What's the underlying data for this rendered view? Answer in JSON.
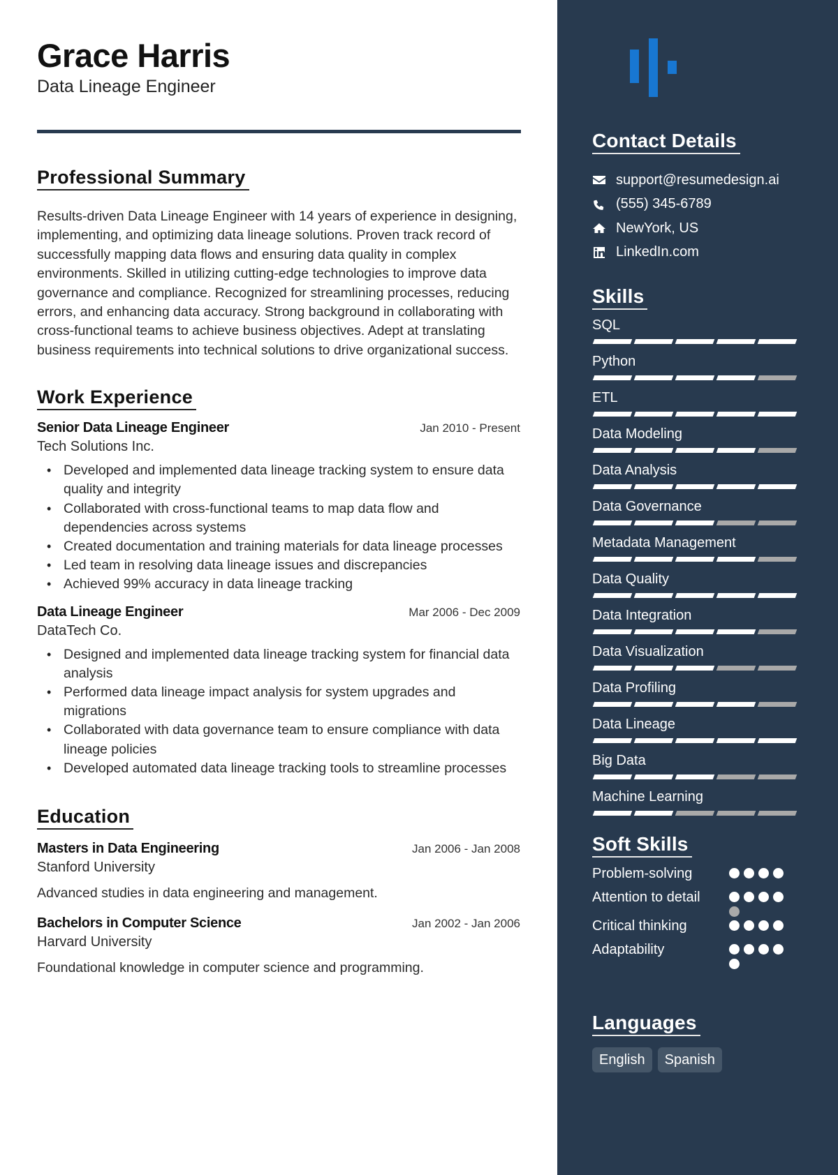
{
  "header": {
    "name": "Grace Harris",
    "title": "Data Lineage Engineer"
  },
  "summary": {
    "heading": "Professional Summary",
    "text": "Results-driven Data Lineage Engineer with 14 years of experience in designing, implementing, and optimizing data lineage solutions. Proven track record of successfully mapping data flows and ensuring data quality in complex environments. Skilled in utilizing cutting-edge technologies to improve data governance and compliance. Recognized for streamlining processes, reducing errors, and enhancing data accuracy. Strong background in collaborating with cross-functional teams to achieve business objectives. Adept at translating business requirements into technical solutions to drive organizational success."
  },
  "work": {
    "heading": "Work Experience",
    "entries": [
      {
        "role": "Senior Data Lineage Engineer",
        "dates": "Jan 2010 - Present",
        "company": "Tech Solutions Inc.",
        "bullets": [
          "Developed and implemented data lineage tracking system to ensure data quality and integrity",
          "Collaborated with cross-functional teams to map data flow and dependencies across systems",
          "Created documentation and training materials for data lineage processes",
          "Led team in resolving data lineage issues and discrepancies",
          "Achieved 99% accuracy in data lineage tracking"
        ]
      },
      {
        "role": "Data Lineage Engineer",
        "dates": "Mar 2006 - Dec 2009",
        "company": "DataTech Co.",
        "bullets": [
          "Designed and implemented data lineage tracking system for financial data analysis",
          "Performed data lineage impact analysis for system upgrades and migrations",
          "Collaborated with data governance team to ensure compliance with data lineage policies",
          "Developed automated data lineage tracking tools to streamline processes"
        ]
      }
    ]
  },
  "education": {
    "heading": "Education",
    "entries": [
      {
        "degree": "Masters in Data Engineering",
        "dates": "Jan 2006 - Jan 2008",
        "school": "Stanford University",
        "description": "Advanced studies in data engineering and management."
      },
      {
        "degree": "Bachelors in Computer Science",
        "dates": "Jan 2002 - Jan 2006",
        "school": "Harvard University",
        "description": "Foundational knowledge in computer science and programming."
      }
    ]
  },
  "sidebar": {
    "logo_icon": "bar-signal-logo",
    "contact": {
      "heading": "Contact Details",
      "items": [
        {
          "icon": "envelope-icon",
          "text": "support@resumedesign.ai"
        },
        {
          "icon": "phone-icon",
          "text": "(555) 345-6789"
        },
        {
          "icon": "home-icon",
          "text": "NewYork, US"
        },
        {
          "icon": "linkedin-icon",
          "text": "LinkedIn.com"
        }
      ]
    },
    "skills": {
      "heading": "Skills",
      "scale_max": 5,
      "items": [
        {
          "name": "SQL",
          "level": 5
        },
        {
          "name": "Python",
          "level": 4
        },
        {
          "name": "ETL",
          "level": 5
        },
        {
          "name": "Data Modeling",
          "level": 4
        },
        {
          "name": "Data Analysis",
          "level": 5
        },
        {
          "name": "Data Governance",
          "level": 3
        },
        {
          "name": "Metadata Management",
          "level": 4
        },
        {
          "name": "Data Quality",
          "level": 5
        },
        {
          "name": "Data Integration",
          "level": 4
        },
        {
          "name": "Data Visualization",
          "level": 3
        },
        {
          "name": "Data Profiling",
          "level": 4
        },
        {
          "name": "Data Lineage",
          "level": 5
        },
        {
          "name": "Big Data",
          "level": 3
        },
        {
          "name": "Machine Learning",
          "level": 2
        }
      ]
    },
    "soft_skills": {
      "heading": "Soft Skills",
      "items": [
        {
          "name": "Problem-solving",
          "filled": 4,
          "total": 4
        },
        {
          "name": "Attention to detail",
          "filled": 4,
          "total": 5
        },
        {
          "name": "Critical thinking",
          "filled": 4,
          "total": 4
        },
        {
          "name": "Adaptability",
          "filled": 5,
          "total": 5
        }
      ]
    },
    "languages": {
      "heading": "Languages",
      "items": [
        "English",
        "Spanish"
      ]
    }
  },
  "colors": {
    "sidebar_bg": "#283a4f",
    "accent_blue": "#1877d2",
    "bar_filled": "#ffffff",
    "bar_empty": "#a9a9a9",
    "chip_bg": "#455668"
  }
}
